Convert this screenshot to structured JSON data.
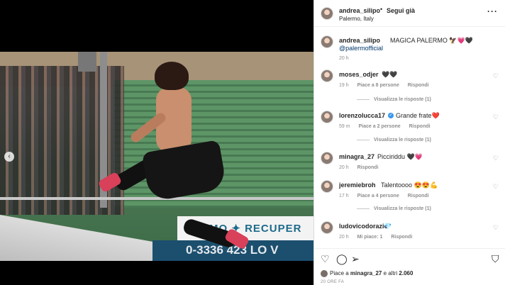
{
  "post": {
    "author": "andrea_silipo",
    "follow_label": "Segui già",
    "separator": "•",
    "location": "Palermo, Italy",
    "more_icon": "more-horizontal-icon"
  },
  "media": {
    "banner_text": "LERMO ✦ RECUPER",
    "board_text": "0-3336 423 LO V",
    "prev_label": "‹"
  },
  "caption": {
    "user": "andrea_silipo",
    "text": "MAGICA PALERMO 🦅💗🖤",
    "mention": "@palermofficial",
    "time": "20 h"
  },
  "comments": [
    {
      "user": "moses_odjer",
      "text": "🖤🖤",
      "time": "19 h",
      "likes": "Piace a 8 persone",
      "reply": "Rispondi",
      "replies": "Visualizza le risposte (1)",
      "verified": false
    },
    {
      "user": "lorenzolucca17",
      "text": "Grande frate❤️",
      "time": "59 m",
      "likes": "Piace a 2 persone",
      "reply": "Rispondi",
      "replies": "Visualizza le risposte (1)",
      "verified": true
    },
    {
      "user": "minagra_27",
      "text": "Picciriddu 🖤💗",
      "time": "20 h",
      "likes": "",
      "reply": "Rispondi",
      "replies": "",
      "verified": false
    },
    {
      "user": "jeremiebroh",
      "text": "Talentoooo 😍😍💪",
      "time": "17 h",
      "likes": "Piace a 4 persone",
      "reply": "Rispondi",
      "replies": "Visualizza le risposte (1)",
      "verified": false
    },
    {
      "user": "ludovicodorazio",
      "text": "💎",
      "time": "20 h",
      "likes": "Mi piace: 1",
      "reply": "Rispondi",
      "replies": "",
      "verified": false
    }
  ],
  "actions": {
    "like_icon": "heart-icon",
    "comment_icon": "comment-icon",
    "share_icon": "send-icon",
    "save_icon": "bookmark-icon",
    "likes_prefix": "Piace a ",
    "likes_user": "minagra_27",
    "likes_suffix": " e altri ",
    "likes_count": "2.060",
    "post_date": "20 ORE FA"
  },
  "colors": {
    "link": "#00376b",
    "muted": "#8e8e8e",
    "verified": "#3897f0",
    "red": "#ed4956"
  }
}
